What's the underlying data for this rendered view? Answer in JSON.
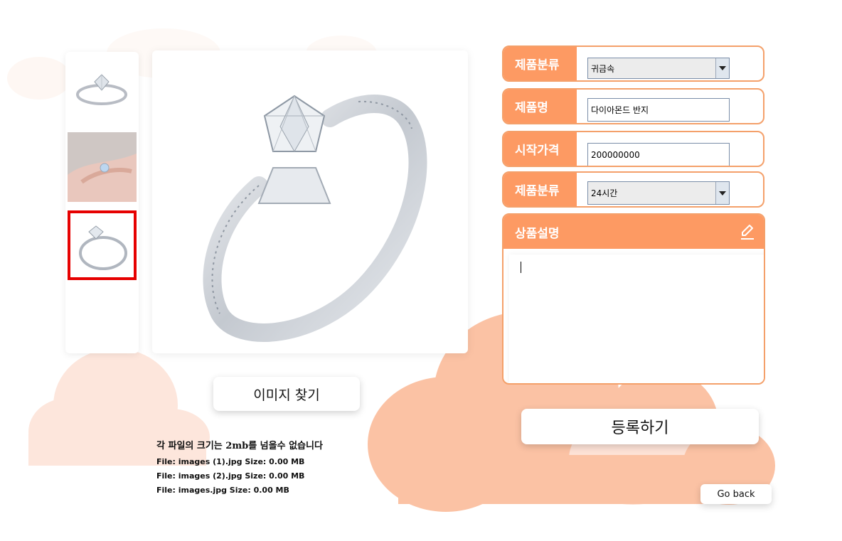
{
  "upload": {
    "find_image_label": "이미지 찾기",
    "size_notice": "각 파일의 크기는 2mb를 넘을수 없습니다",
    "files": [
      "File: images (1).jpg Size: 0.00 MB",
      "File: images (2).jpg Size: 0.00 MB",
      "File: images.jpg Size: 0.00 MB"
    ]
  },
  "form": {
    "category": {
      "label": "제품분류",
      "value": "귀금속"
    },
    "name": {
      "label": "제품명",
      "value": "다이아몬드 반지"
    },
    "start_price": {
      "label": "시작가격",
      "value": "200000000"
    },
    "duration": {
      "label": "제품분류",
      "value": "24시간"
    },
    "description": {
      "label": "상품설명",
      "value": ""
    }
  },
  "actions": {
    "register_label": "등록하기",
    "go_back_label": "Go back"
  },
  "colors": {
    "accent": "#fd9a63",
    "accent_border": "#f4a06a",
    "cloud_light": "#fde6dc",
    "cloud_dark": "#fbc2a4",
    "selected_outline": "#e60000"
  },
  "icons": {
    "edit": "pencil-icon",
    "dropdown": "triangle-down-icon"
  }
}
